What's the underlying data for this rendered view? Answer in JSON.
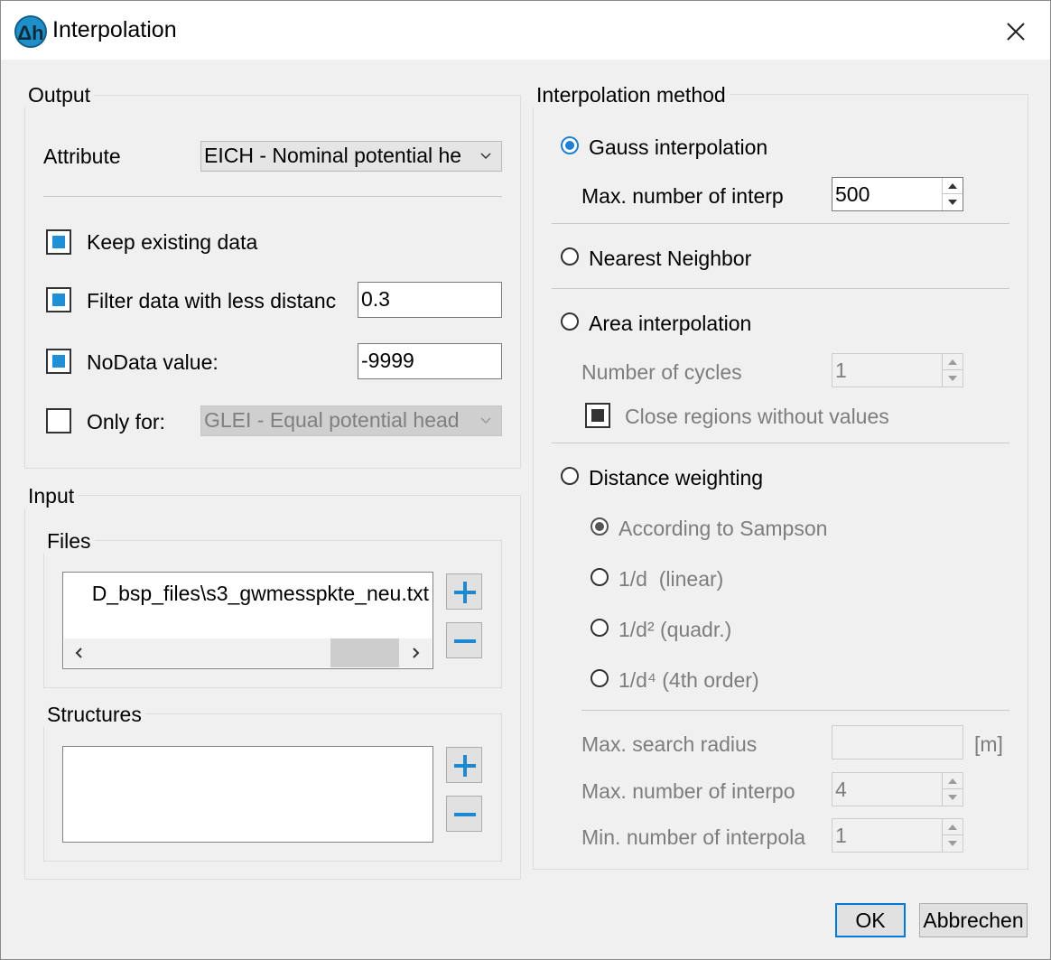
{
  "window": {
    "title": "Interpolation",
    "app_icon_text": "Δh"
  },
  "output": {
    "legend": "Output",
    "attribute_label": "Attribute",
    "attribute_value": "EICH - Nominal potential he",
    "keep_existing_label": "Keep existing data",
    "filter_label": "Filter data with less distanc",
    "filter_value": "0.3",
    "nodata_label": "NoData value:",
    "nodata_value": "-9999",
    "only_for_label": "Only for:",
    "only_for_value": "GLEI - Equal potential head"
  },
  "input": {
    "legend": "Input",
    "files_legend": "Files",
    "files_item": "D_bsp_files\\s3_gwmesspkte_neu.txt",
    "structures_legend": "Structures"
  },
  "method": {
    "legend": "Interpolation method",
    "gauss_label": "Gauss interpolation",
    "gauss_max_label": "Max. number of interp",
    "gauss_max_value": "500",
    "nearest_label": "Nearest Neighbor",
    "area_label": "Area interpolation",
    "cycles_label": "Number of cycles",
    "cycles_value": "1",
    "close_regions_label": "Close regions without values",
    "distance_label": "Distance weighting",
    "sampson_label": "According to Sampson",
    "linear_label": "1/d  (linear)",
    "quadr_label": "1/d² (quadr.)",
    "fourth_label": "1/d⁴ (4th order)",
    "search_radius_label": "Max. search radius",
    "search_radius_value": "",
    "search_radius_unit": "[m]",
    "max_interp_label": "Max. number of interpo",
    "max_interp_value": "4",
    "min_interp_label": "Min. number of interpola",
    "min_interp_value": "1"
  },
  "buttons": {
    "ok": "OK",
    "cancel": "Abbrechen"
  },
  "colors": {
    "accent": "#1f8fd6",
    "plus_minus": "#1e88d0",
    "default_border": "#0078d7"
  }
}
